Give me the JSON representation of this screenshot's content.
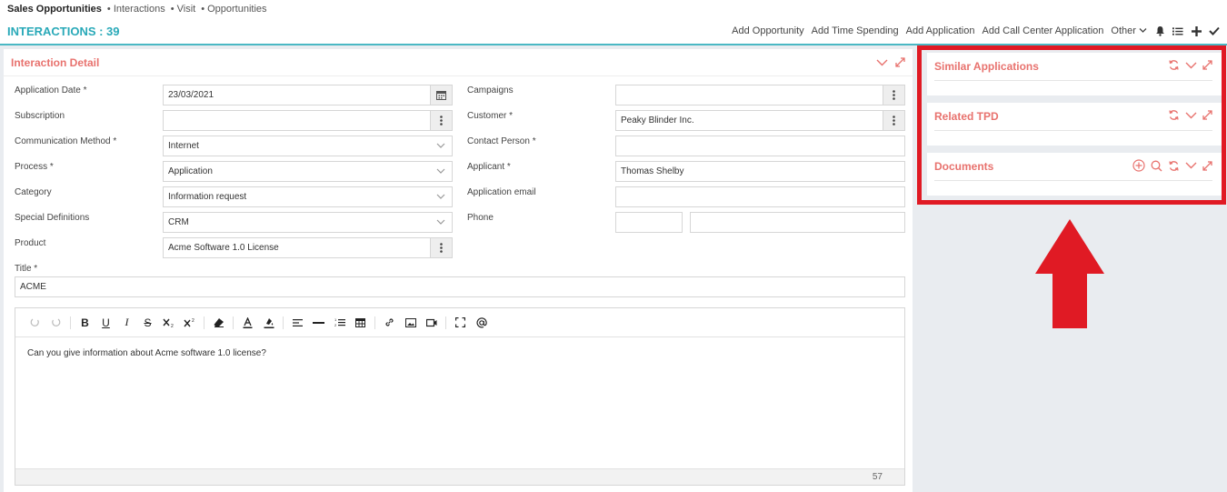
{
  "breadcrumb": {
    "main": "Sales Opportunities",
    "items": [
      "• Interactions",
      "• Visit",
      "• Opportunities"
    ]
  },
  "header": {
    "title": "INTERACTIONS : 39",
    "actions": [
      "Add Opportunity",
      "Add Time Spending",
      "Add Application",
      "Add Call Center Application",
      "Other"
    ]
  },
  "detail": {
    "title": "Interaction Detail",
    "left_fields": [
      {
        "label": "Application Date *",
        "value": "23/03/2021"
      },
      {
        "label": "Subscription",
        "value": ""
      },
      {
        "label": "Communication Method *",
        "value": "Internet"
      },
      {
        "label": "Process *",
        "value": "Application"
      },
      {
        "label": "Category",
        "value": "Information request"
      },
      {
        "label": "Special Definitions",
        "value": "CRM"
      },
      {
        "label": "Product",
        "value": "Acme Software 1.0 License"
      }
    ],
    "right_fields": [
      {
        "label": "Campaigns",
        "value": ""
      },
      {
        "label": "Customer *",
        "value": "Peaky Blinder Inc."
      },
      {
        "label": "Contact Person *",
        "value": ""
      },
      {
        "label": "Applicant *",
        "value": "Thomas Shelby"
      },
      {
        "label": "Application email",
        "value": ""
      },
      {
        "label": "Phone",
        "value": ""
      }
    ],
    "title_label": "Title *",
    "title_value": "ACME",
    "editor_text": "Can you give information about Acme software 1.0 license?",
    "char_count": "57"
  },
  "widgets": [
    {
      "title": "Similar Applications"
    },
    {
      "title": "Related TPD"
    },
    {
      "title": "Documents"
    }
  ],
  "colors": {
    "accent": "#29a9b8",
    "panel_title": "#e8726e",
    "highlight": "#e01a24"
  }
}
